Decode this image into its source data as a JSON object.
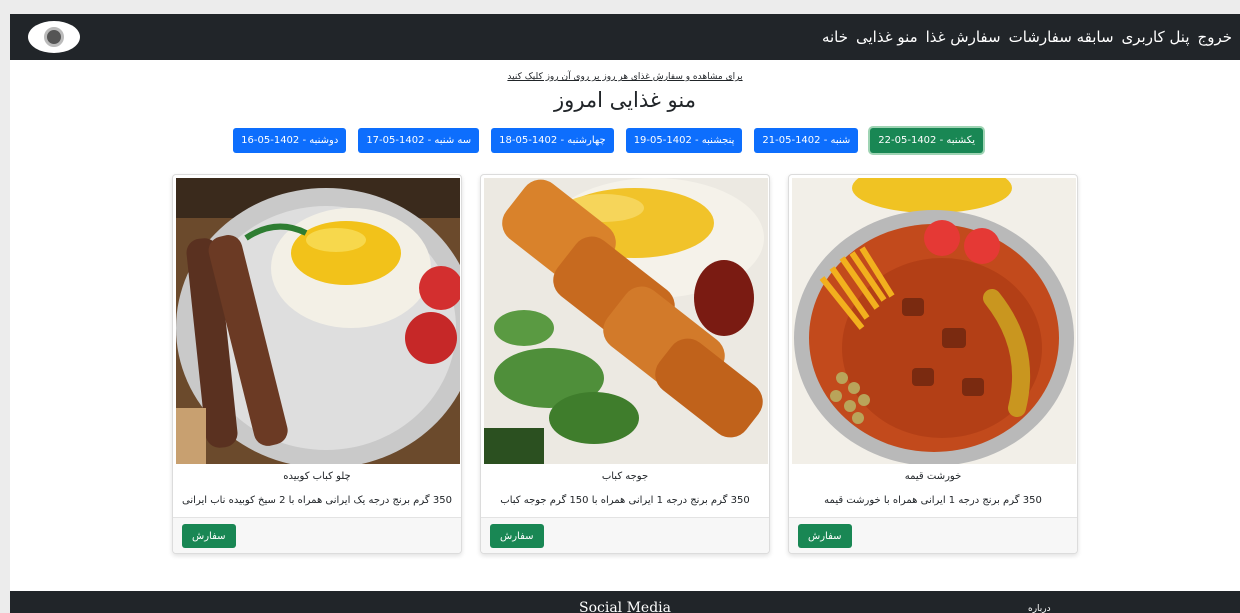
{
  "nav": {
    "links": [
      "خانه",
      "منو غذایی",
      "سفارش غذا",
      "سابقه سفارشات",
      "پنل کاربری",
      "خروج"
    ]
  },
  "header": {
    "hint": "برای مشاهده و سفارش غذای هر روز بر روی آن روز کلیک کنید",
    "title": "منو غذایی امروز"
  },
  "days": [
    {
      "label": "دوشنبه - 1402-05-16",
      "active": false
    },
    {
      "label": "سه شنبه - 1402-05-17",
      "active": false
    },
    {
      "label": "چهارشنبه - 1402-05-18",
      "active": false
    },
    {
      "label": "پنجشنبه - 1402-05-19",
      "active": false
    },
    {
      "label": "شنبه - 1402-05-21",
      "active": false
    },
    {
      "label": "یکشنبه - 1402-05-22",
      "active": true
    }
  ],
  "cards": [
    {
      "name": "چلو کباب کوبیده",
      "desc": "350 گرم برنج درجه یک ایرانی همراه با 2 سیخ کوبیده ناب ایرانی",
      "order": "سفارش",
      "image": "kabab-koobideh-photo"
    },
    {
      "name": "جوجه کباب",
      "desc": "350 گرم برنج درجه 1 ایرانی همراه با 150 گرم جوجه کباب",
      "order": "سفارش",
      "image": "joojeh-kabab-photo"
    },
    {
      "name": "خورشت قیمه",
      "desc": "350 گرم برنج درجه 1 ایرانی همراه با خورشت قیمه",
      "order": "سفارش",
      "image": "khoresh-gheimeh-photo"
    }
  ],
  "footer": {
    "social": "Social Media",
    "about": "درباره"
  },
  "colors": {
    "navbar": "#212529",
    "primary": "#0d6efd",
    "success": "#198754"
  }
}
